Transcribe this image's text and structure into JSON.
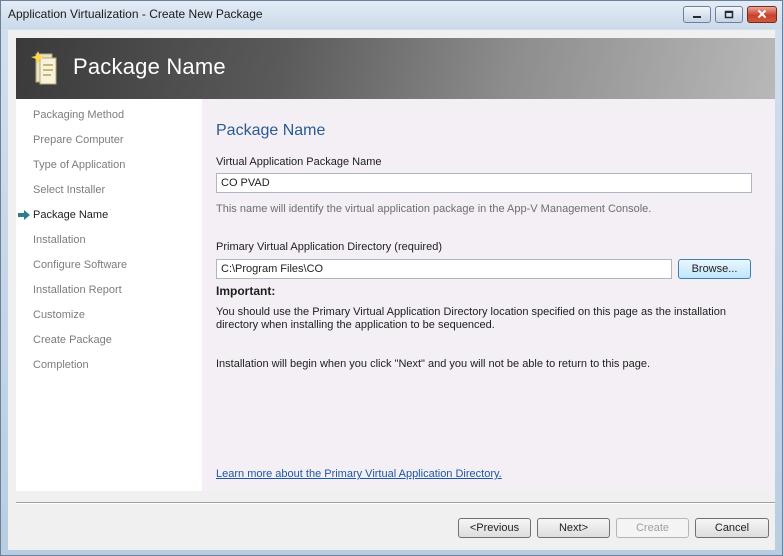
{
  "window": {
    "title": "Application Virtualization - Create New Package",
    "controls": {
      "minimize_icon": "minimize-icon",
      "maximize_icon": "maximize-icon",
      "close_icon": "close-icon"
    }
  },
  "banner": {
    "title": "Package Name",
    "icon": "package-wizard-icon"
  },
  "nav": {
    "items": [
      {
        "label": "Packaging Method",
        "active": false
      },
      {
        "label": "Prepare Computer",
        "active": false
      },
      {
        "label": "Type of Application",
        "active": false
      },
      {
        "label": "Select Installer",
        "active": false
      },
      {
        "label": "Package Name",
        "active": true
      },
      {
        "label": "Installation",
        "active": false
      },
      {
        "label": "Configure Software",
        "active": false
      },
      {
        "label": "Installation Report",
        "active": false
      },
      {
        "label": "Customize",
        "active": false
      },
      {
        "label": "Create Package",
        "active": false
      },
      {
        "label": "Completion",
        "active": false
      }
    ],
    "current_icon": "arrow-right-icon"
  },
  "main": {
    "heading": "Package Name",
    "package_name_label": "Virtual Application Package Name",
    "package_name_value": "CO PVAD",
    "package_name_hint": "This name will identify the virtual application package in the App-V Management Console.",
    "directory_label": "Primary Virtual Application Directory (required)",
    "directory_value": "C:\\Program Files\\CO",
    "browse_label": "Browse...",
    "important_label": "Important:",
    "important_text_line1": "You should use the Primary Virtual Application Directory location specified on this page as the installation",
    "important_text_line2": "directory when installing the application to be sequenced.",
    "next_note": "Installation will begin when you click \"Next\" and you will not be able to return to this page.",
    "learn_more_link": "Learn more about the Primary Virtual Application Directory."
  },
  "footer": {
    "previous_label": "<Previous",
    "next_label": "Next>",
    "create_label": "Create",
    "cancel_label": "Cancel"
  },
  "colors": {
    "heading": "#2a5a92",
    "link": "#1d59a3",
    "nav_inactive": "#7d7d7d",
    "arrow": "#2e7d8c"
  }
}
